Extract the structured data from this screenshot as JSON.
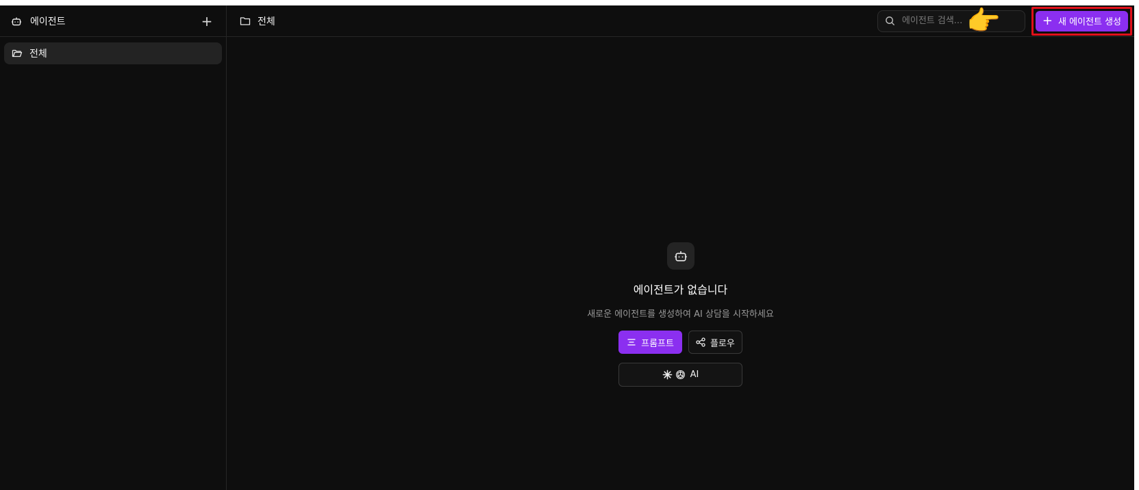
{
  "sidebar": {
    "header": {
      "icon": "robot-icon",
      "title": "에이전트",
      "add_label": "+"
    },
    "items": [
      {
        "icon": "folder-open-icon",
        "label": "전체",
        "selected": true
      }
    ]
  },
  "topbar": {
    "breadcrumb": {
      "icon": "folder-icon",
      "label": "전체"
    },
    "search": {
      "icon": "search-icon",
      "placeholder": "에이전트 검색...",
      "value": ""
    },
    "new_button": {
      "icon": "plus-icon",
      "label": "새 에이전트 생성"
    },
    "pointer": {
      "icon": "pointing-hand-icon",
      "glyph": "👉"
    }
  },
  "empty_state": {
    "icon": "robot-icon",
    "heading": "에이전트가 없습니다",
    "subtext": "새로운 에이전트를 생성하여 AI 상담을 시작하세요",
    "buttons": {
      "prompt": {
        "icon": "text-lines-icon",
        "label": "프롬프트"
      },
      "flow": {
        "icon": "share-nodes-icon",
        "label": "플로우"
      },
      "ai": {
        "icons": [
          "sparkle-icon",
          "openai-icon"
        ],
        "label": "AI"
      }
    }
  },
  "colors": {
    "accent": "#8b2ff0",
    "highlight_border": "#e0101a",
    "background": "#0e0e0e"
  }
}
